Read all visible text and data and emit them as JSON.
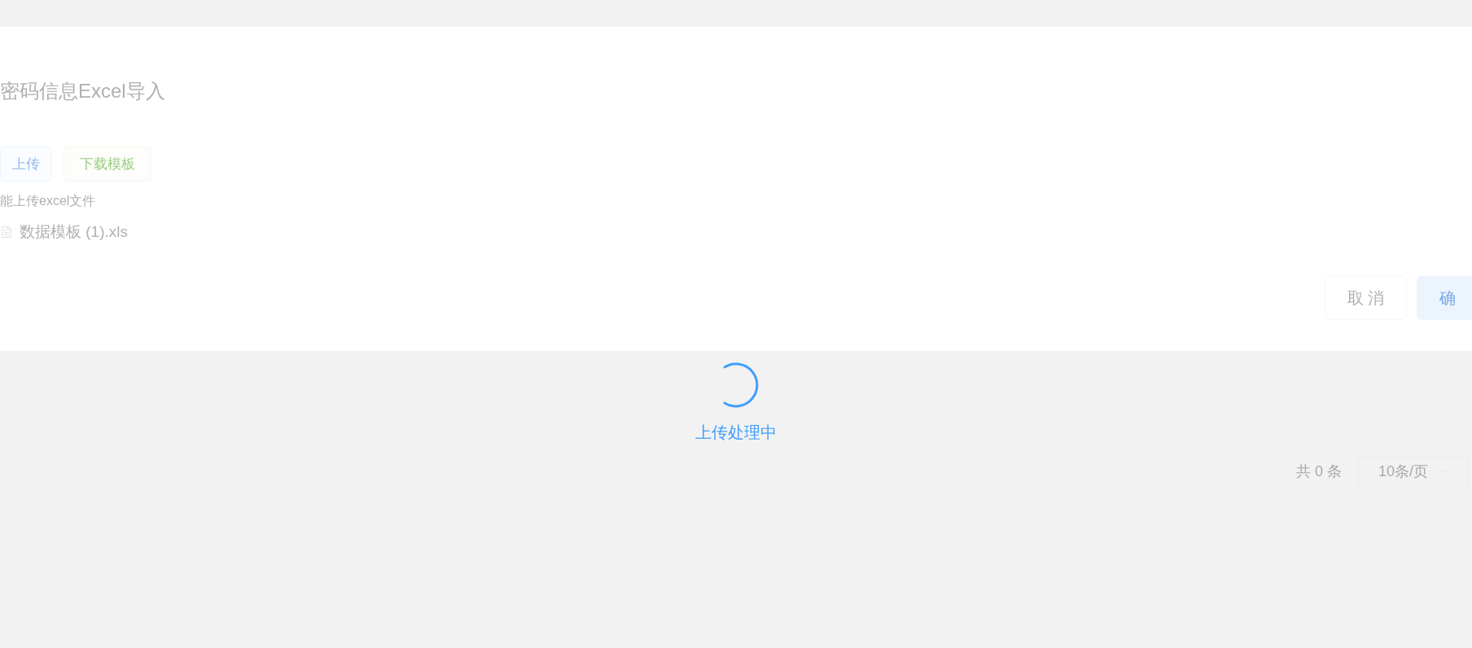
{
  "dialog": {
    "title": "密码信息Excel导入",
    "upload_button": "上传",
    "download_button": "下载模板",
    "hint": "能上传excel文件",
    "files": [
      {
        "name": "数据模板 (1).xls"
      }
    ],
    "cancel_button": "取 消",
    "confirm_button": "确"
  },
  "loading": {
    "text": "上传处理中"
  },
  "pagination": {
    "total": "共 0 条",
    "page_size": "10条/页"
  }
}
